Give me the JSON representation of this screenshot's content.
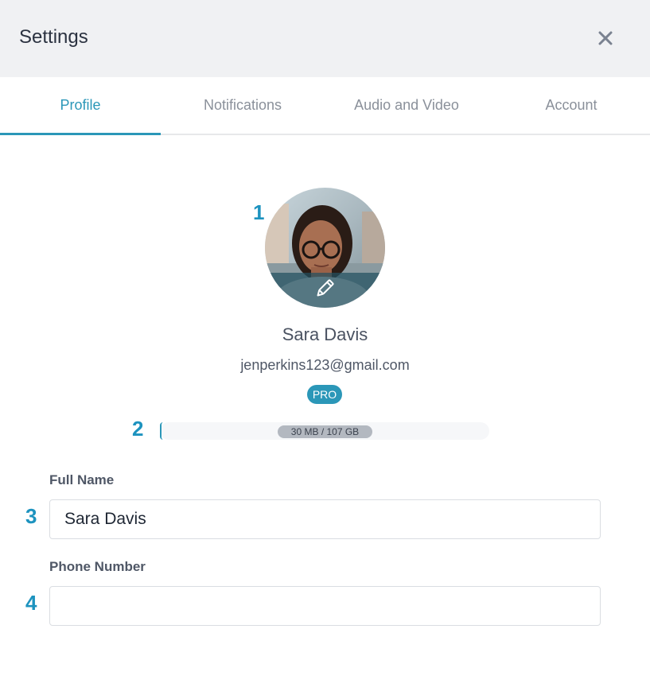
{
  "header": {
    "title": "Settings",
    "close_icon": "close-icon"
  },
  "tabs": [
    {
      "label": "Profile",
      "active": true
    },
    {
      "label": "Notifications",
      "active": false
    },
    {
      "label": "Audio and Video",
      "active": false
    },
    {
      "label": "Account",
      "active": false
    }
  ],
  "markers": [
    "1",
    "2",
    "3",
    "4"
  ],
  "profile": {
    "avatar_icon": "user-photo",
    "edit_icon": "pencil-icon",
    "name": "Sara Davis",
    "email": "jenperkins123@gmail.com",
    "badge": "PRO"
  },
  "storage": {
    "label": "30 MB / 107 GB",
    "used_fraction": 0.0003
  },
  "form": {
    "full_name": {
      "label": "Full Name",
      "value": "Sara Davis",
      "placeholder": ""
    },
    "phone": {
      "label": "Phone Number",
      "value": "",
      "placeholder": ""
    }
  },
  "colors": {
    "accent": "#2b97b8",
    "marker": "#1d93bf",
    "header_bg": "#f0f1f3"
  }
}
